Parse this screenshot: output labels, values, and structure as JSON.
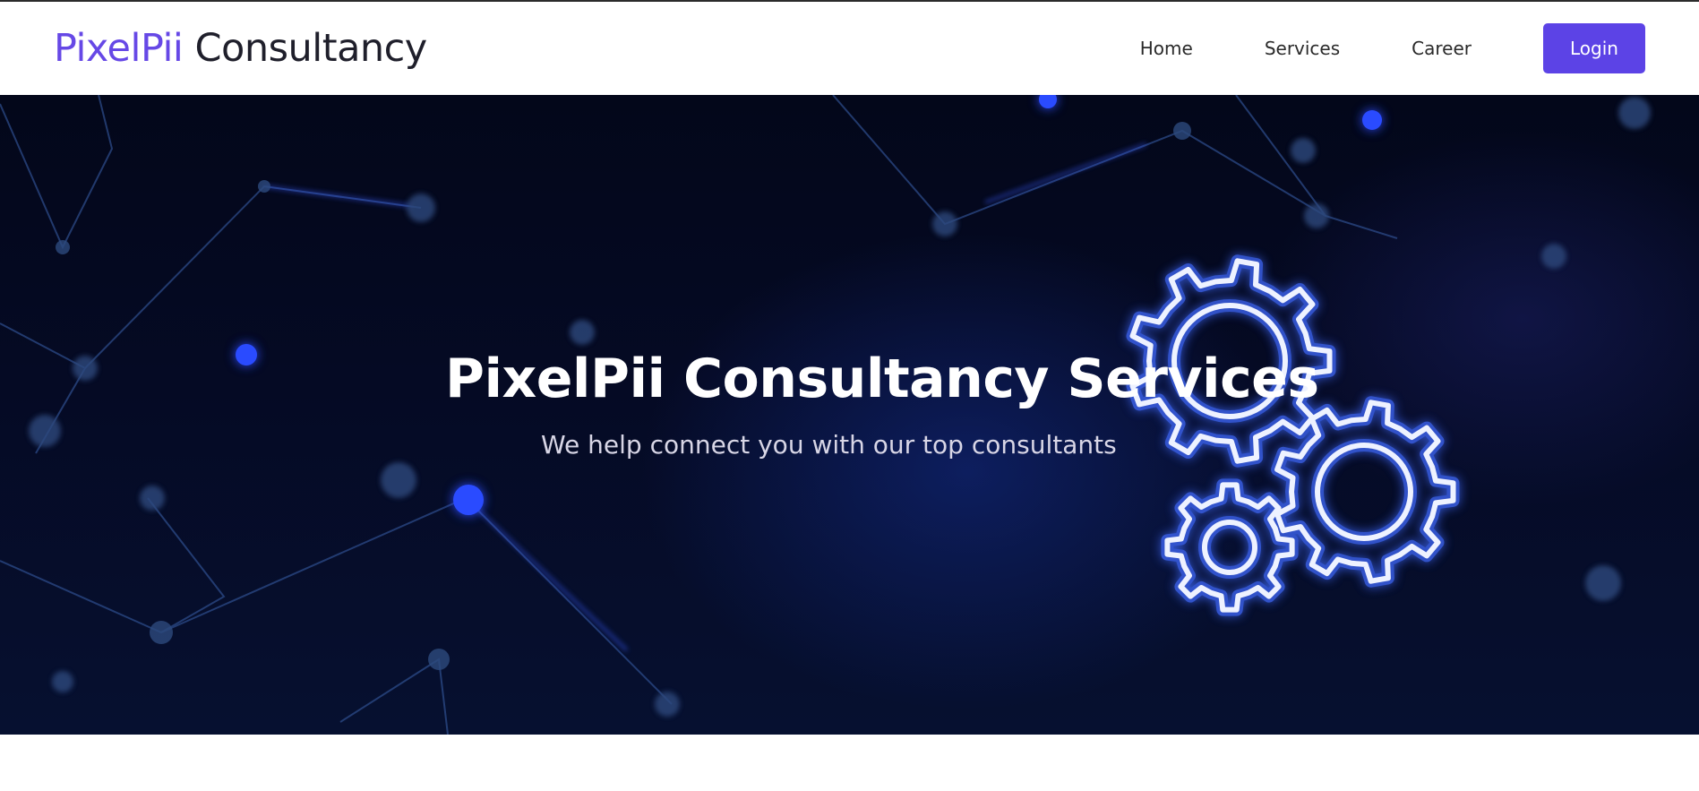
{
  "brand": {
    "accent": "PixelPii",
    "rest": "Consultancy"
  },
  "nav": {
    "home": "Home",
    "services": "Services",
    "career": "Career",
    "login": "Login"
  },
  "hero": {
    "title": "PixelPii Consultancy Services",
    "subtitle": "We help connect you with our top consultants",
    "illustration": "gears-icon"
  },
  "colors": {
    "accent": "#5c43e6",
    "hero_bg": "#050a24",
    "gear_glow": "#3f6bff"
  }
}
